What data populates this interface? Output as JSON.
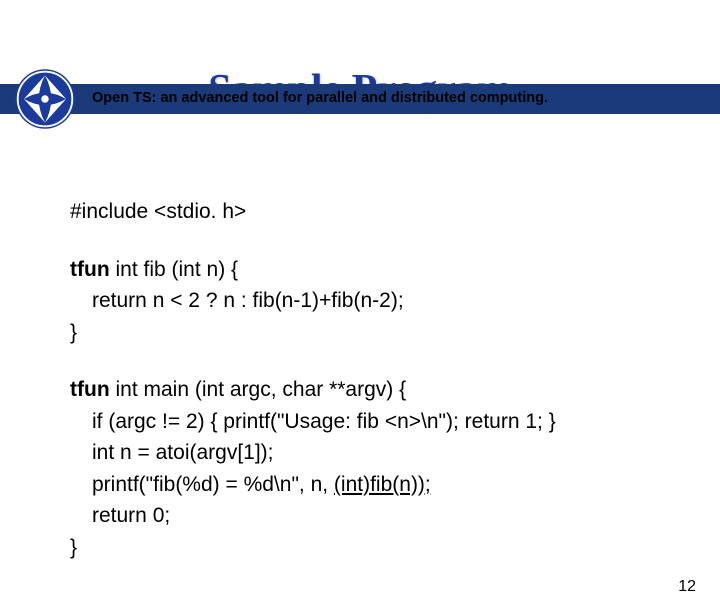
{
  "header": {
    "title": "Open TS: an advanced tool for parallel and distributed computing."
  },
  "slide": {
    "title": "Sample Program"
  },
  "code": {
    "include": "#include <stdio. h>",
    "fib": {
      "kw": "tfun",
      "sig": " int fib (int n) {",
      "body": "return n < 2  ?  n : fib(n-1)+fib(n-2);",
      "close": "}"
    },
    "main": {
      "kw": "tfun",
      "sig": " int main (int argc, char **argv) {",
      "l1": "if (argc != 2) { printf(\"Usage: fib <n>\\n\"); return 1; }",
      "l2": "int n = atoi(argv[1]);",
      "l3a": "printf(\"fib(%d) = %d\\n\", n, ",
      "l3b": "(int)fib(n));",
      "l4": "return 0;",
      "close": "}"
    }
  },
  "page": "12"
}
